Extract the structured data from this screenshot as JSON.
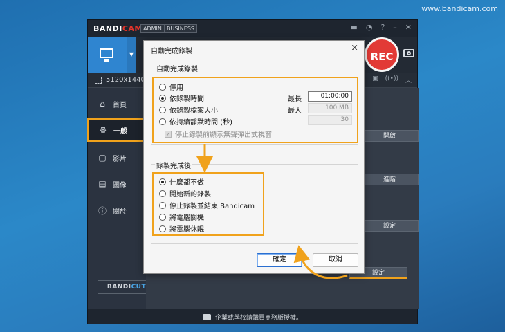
{
  "watermark": "www.bandicam.com",
  "app": {
    "logo_main": "BANDI",
    "logo_accent": "CAM",
    "tag_admin": "ADMIN",
    "tag_business": "BUSINESS",
    "resolution": "5120x1440 -",
    "rec_label": "REC",
    "sidebar": {
      "items": [
        {
          "label": "首頁",
          "icon": "home-icon"
        },
        {
          "label": "一般",
          "icon": "gear-icon"
        },
        {
          "label": "影片",
          "icon": "video-icon"
        },
        {
          "label": "圖像",
          "icon": "image-icon"
        },
        {
          "label": "關於",
          "icon": "info-icon"
        }
      ]
    },
    "side_buttons": {
      "open": "開啟",
      "advanced": "進階",
      "settings_1": "設定",
      "settings_2": "設定"
    },
    "bandicut_main": "BANDI",
    "bandicut_accent": "CUT",
    "bandicut_arrows": "»",
    "footer": "企業或學校請購買商務版授權。",
    "colors": {
      "accent_orange": "#f0a21c",
      "rec_red": "#e23a36",
      "screen_blue": "#2f85d0"
    }
  },
  "dialog": {
    "title": "自動完成錄製",
    "close": "×",
    "group1": {
      "title": "自動完成錄製",
      "options": [
        {
          "label": "停用",
          "selected": false
        },
        {
          "label": "依錄製時間",
          "selected": true
        },
        {
          "label": "依錄製檔案大小",
          "selected": false
        },
        {
          "label": "依持續靜默時間 (秒)",
          "selected": false
        }
      ],
      "max_label_1": "最長",
      "max_label_2": "最大",
      "time_value": "01:00:00",
      "size_value": "100 MB",
      "silence_value": "30",
      "checkbox_label": "停止錄製前顯示無聲彈出式視窗",
      "checkbox_checked": true
    },
    "group2": {
      "title": "錄製完成後",
      "options": [
        {
          "label": "什麼都不做",
          "selected": true
        },
        {
          "label": "開始新的錄製",
          "selected": false
        },
        {
          "label": "停止錄製並結束 Bandicam",
          "selected": false
        },
        {
          "label": "將電腦關機",
          "selected": false
        },
        {
          "label": "將電腦休眠",
          "selected": false
        }
      ]
    },
    "ok": "確定",
    "cancel": "取消"
  }
}
